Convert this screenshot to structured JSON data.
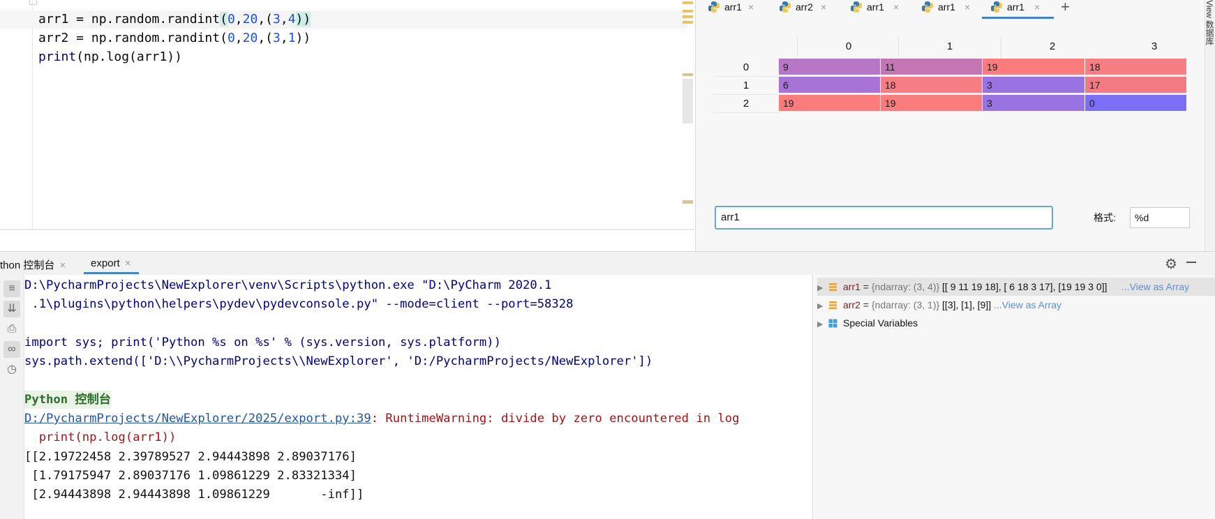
{
  "editor": {
    "lines": [
      {
        "prefix": "arr1 = np.random.randint",
        "open": "(",
        "a": "0",
        "sep1": ",",
        "b": "20",
        "sep2": ",(",
        "c": "3",
        "sep3": ",",
        "d": "4",
        "close": "))"
      },
      {
        "prefix": "arr2 = np.random.randint",
        "open": "(",
        "a": "0",
        "sep1": ",",
        "b": "20",
        "sep2": ",(",
        "c": "3",
        "sep3": ",",
        "d": "1",
        "close": "))"
      },
      {
        "fn": "print",
        "rest": "(np.log(arr1))"
      }
    ]
  },
  "sciview": {
    "tabs": [
      {
        "label": "arr1"
      },
      {
        "label": "arr2"
      },
      {
        "label": "arr1"
      },
      {
        "label": "arr1"
      },
      {
        "label": "arr1",
        "active": true
      }
    ],
    "add_tab_icon": "plus-icon",
    "columns": [
      "0",
      "1",
      "2",
      "3"
    ],
    "rows": [
      {
        "label": "0",
        "cells": [
          "9",
          "11",
          "19",
          "18"
        ]
      },
      {
        "label": "1",
        "cells": [
          "6",
          "18",
          "3",
          "17"
        ]
      },
      {
        "label": "2",
        "cells": [
          "19",
          "19",
          "3",
          "0"
        ]
      }
    ],
    "heat_colors": {
      "0": "#7b6ff5",
      "3": "#9a73e3",
      "6": "#a873d6",
      "9": "#b677c6",
      "11": "#c376b2",
      "17": "#f07b82",
      "18": "#f77e82",
      "19": "#fb7c7c"
    },
    "name_field_value": "arr1",
    "format_label": "格式:",
    "format_value": "%d",
    "side_strip_text": "View  数据库"
  },
  "console": {
    "tabs": [
      {
        "label": "thon 控制台"
      },
      {
        "label": "export",
        "active": true
      }
    ],
    "lines": [
      {
        "type": "cmd",
        "text": "D:\\PycharmProjects\\NewExplorer\\venv\\Scripts\\python.exe \"D:\\PyCharm 2020.1"
      },
      {
        "type": "cmd",
        "text": " .1\\plugins\\python\\helpers\\pydev\\pydevconsole.py\" --mode=client --port=58328"
      },
      {
        "type": "blank",
        "text": ""
      },
      {
        "type": "cmd",
        "text": "import sys; print('Python %s on %s' % (sys.version, sys.platform))"
      },
      {
        "type": "cmd",
        "text": "sys.path.extend(['D:\\\\PycharmProjects\\\\NewExplorer', 'D:/PycharmProjects/NewExplorer'])"
      },
      {
        "type": "blank",
        "text": ""
      },
      {
        "type": "hdr",
        "text": "Python 控制台"
      }
    ],
    "warning": {
      "link": "D:/PycharmProjects/NewExplorer/2025/export.py:39",
      "message": ": RuntimeWarning: divide by zero encountered in log"
    },
    "warning_line": "  print(np.log(arr1))",
    "output": [
      "[[2.19722458 2.39789527 2.94443898 2.89037176]",
      " [1.79175947 2.89037176 1.09861229 2.83321334]",
      " [2.94443898 2.94443898 1.09861229       -inf]]"
    ]
  },
  "variables": [
    {
      "name": "arr1",
      "eq": " = ",
      "type": "{ndarray: (3, 4)}",
      "value": " [[ 9 11 19 18], [ 6 18  3 17], [19 19  3  0]]",
      "link": "...View as Array",
      "icon": "array-icon",
      "selected": true
    },
    {
      "name": "arr2",
      "eq": " = ",
      "type": "{ndarray: (3, 1)}",
      "value": " [[3], [1], [9]] ",
      "link": "...View as Array",
      "icon": "array-icon"
    },
    {
      "name": "Special Variables",
      "icon": "special-variables-icon"
    }
  ]
}
